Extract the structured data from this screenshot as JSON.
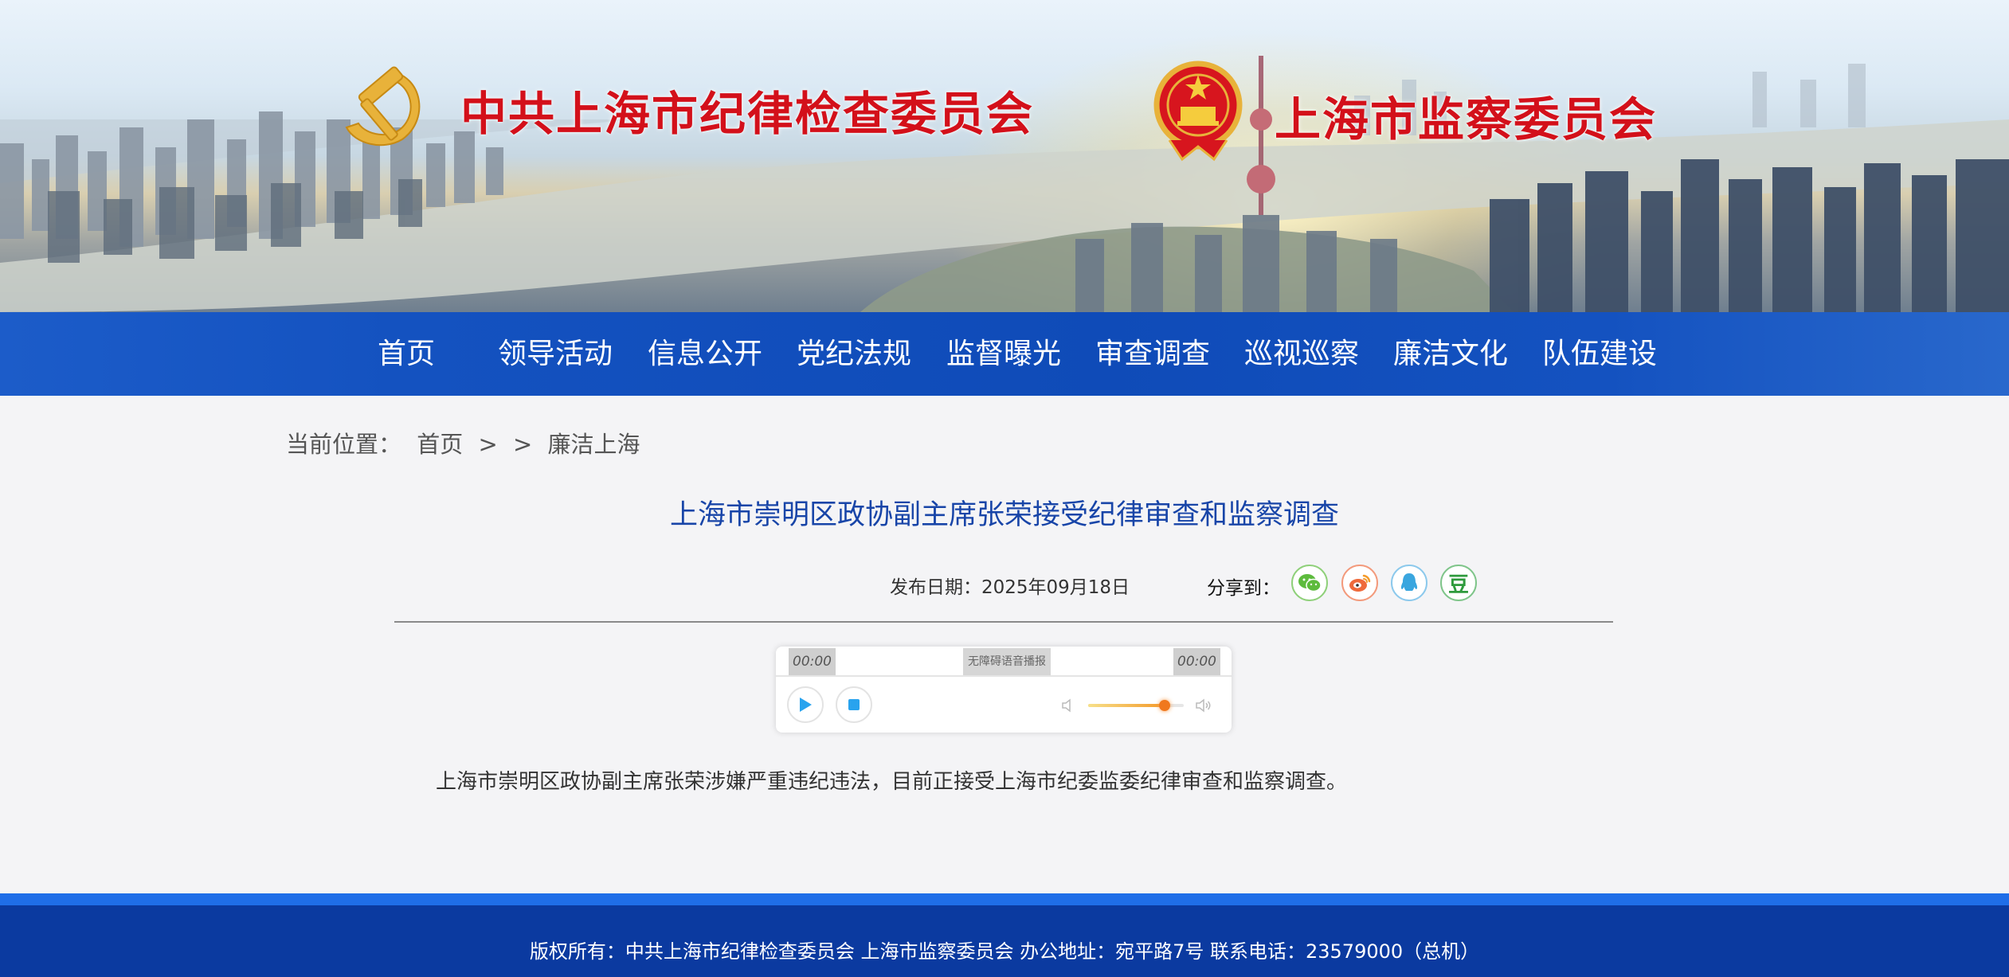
{
  "header": {
    "left_title": "中共上海市纪律检查委员会",
    "right_title": "上海市监察委员会"
  },
  "nav": {
    "items": [
      {
        "label": "首页"
      },
      {
        "label": "领导活动"
      },
      {
        "label": "信息公开"
      },
      {
        "label": "党纪法规"
      },
      {
        "label": "监督曝光"
      },
      {
        "label": "审查调查"
      },
      {
        "label": "巡视巡察"
      },
      {
        "label": "廉洁文化"
      },
      {
        "label": "队伍建设"
      }
    ]
  },
  "breadcrumb": {
    "prefix": "当前位置：",
    "home": "首页",
    "sep1": ">",
    "sep2": ">",
    "current": "廉洁上海"
  },
  "article": {
    "title": "上海市崇明区政协副主席张荣接受纪律审查和监察调查",
    "date_label": "发布日期：2025年09月18日",
    "share_label": "分享到：",
    "body": "上海市崇明区政协副主席张荣涉嫌严重违纪违法，目前正接受上海市纪委监委纪律审查和监察调查。"
  },
  "share_icons": [
    {
      "icon": "wechat-icon",
      "color": "#5dbb3d"
    },
    {
      "icon": "weibo-icon",
      "color": "#ef6a3b"
    },
    {
      "icon": "qq-icon",
      "color": "#3aa6df"
    },
    {
      "icon": "douban-icon",
      "color": "#2e9a3c",
      "glyph": "豆"
    }
  ],
  "player": {
    "current_time": "00:00",
    "total_time": "00:00",
    "caption": "无障碍语音播报",
    "volume_percent": 80,
    "accent_color": "#29a3ee"
  },
  "footer": {
    "text": "版权所有：中共上海市纪律检查委员会 上海市监察委员会 办公地址：宛平路7号 联系电话：23579000（总机）"
  }
}
